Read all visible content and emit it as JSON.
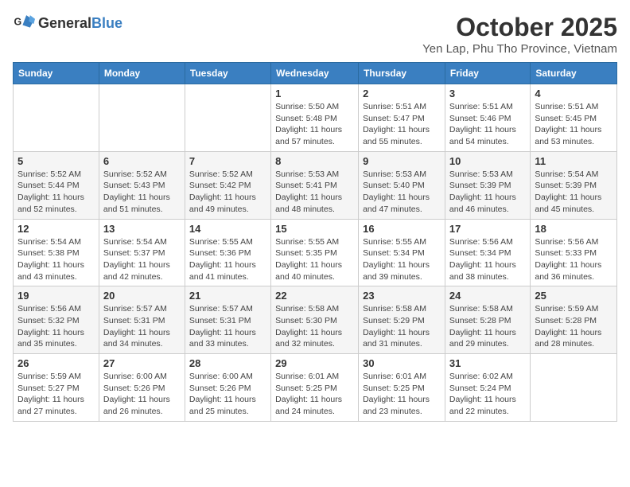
{
  "logo": {
    "text_general": "General",
    "text_blue": "Blue"
  },
  "title": "October 2025",
  "subtitle": "Yen Lap, Phu Tho Province, Vietnam",
  "weekdays": [
    "Sunday",
    "Monday",
    "Tuesday",
    "Wednesday",
    "Thursday",
    "Friday",
    "Saturday"
  ],
  "weeks": [
    [
      {
        "day": "",
        "info": ""
      },
      {
        "day": "",
        "info": ""
      },
      {
        "day": "",
        "info": ""
      },
      {
        "day": "1",
        "info": "Sunrise: 5:50 AM\nSunset: 5:48 PM\nDaylight: 11 hours and 57 minutes."
      },
      {
        "day": "2",
        "info": "Sunrise: 5:51 AM\nSunset: 5:47 PM\nDaylight: 11 hours and 55 minutes."
      },
      {
        "day": "3",
        "info": "Sunrise: 5:51 AM\nSunset: 5:46 PM\nDaylight: 11 hours and 54 minutes."
      },
      {
        "day": "4",
        "info": "Sunrise: 5:51 AM\nSunset: 5:45 PM\nDaylight: 11 hours and 53 minutes."
      }
    ],
    [
      {
        "day": "5",
        "info": "Sunrise: 5:52 AM\nSunset: 5:44 PM\nDaylight: 11 hours and 52 minutes."
      },
      {
        "day": "6",
        "info": "Sunrise: 5:52 AM\nSunset: 5:43 PM\nDaylight: 11 hours and 51 minutes."
      },
      {
        "day": "7",
        "info": "Sunrise: 5:52 AM\nSunset: 5:42 PM\nDaylight: 11 hours and 49 minutes."
      },
      {
        "day": "8",
        "info": "Sunrise: 5:53 AM\nSunset: 5:41 PM\nDaylight: 11 hours and 48 minutes."
      },
      {
        "day": "9",
        "info": "Sunrise: 5:53 AM\nSunset: 5:40 PM\nDaylight: 11 hours and 47 minutes."
      },
      {
        "day": "10",
        "info": "Sunrise: 5:53 AM\nSunset: 5:39 PM\nDaylight: 11 hours and 46 minutes."
      },
      {
        "day": "11",
        "info": "Sunrise: 5:54 AM\nSunset: 5:39 PM\nDaylight: 11 hours and 45 minutes."
      }
    ],
    [
      {
        "day": "12",
        "info": "Sunrise: 5:54 AM\nSunset: 5:38 PM\nDaylight: 11 hours and 43 minutes."
      },
      {
        "day": "13",
        "info": "Sunrise: 5:54 AM\nSunset: 5:37 PM\nDaylight: 11 hours and 42 minutes."
      },
      {
        "day": "14",
        "info": "Sunrise: 5:55 AM\nSunset: 5:36 PM\nDaylight: 11 hours and 41 minutes."
      },
      {
        "day": "15",
        "info": "Sunrise: 5:55 AM\nSunset: 5:35 PM\nDaylight: 11 hours and 40 minutes."
      },
      {
        "day": "16",
        "info": "Sunrise: 5:55 AM\nSunset: 5:34 PM\nDaylight: 11 hours and 39 minutes."
      },
      {
        "day": "17",
        "info": "Sunrise: 5:56 AM\nSunset: 5:34 PM\nDaylight: 11 hours and 38 minutes."
      },
      {
        "day": "18",
        "info": "Sunrise: 5:56 AM\nSunset: 5:33 PM\nDaylight: 11 hours and 36 minutes."
      }
    ],
    [
      {
        "day": "19",
        "info": "Sunrise: 5:56 AM\nSunset: 5:32 PM\nDaylight: 11 hours and 35 minutes."
      },
      {
        "day": "20",
        "info": "Sunrise: 5:57 AM\nSunset: 5:31 PM\nDaylight: 11 hours and 34 minutes."
      },
      {
        "day": "21",
        "info": "Sunrise: 5:57 AM\nSunset: 5:31 PM\nDaylight: 11 hours and 33 minutes."
      },
      {
        "day": "22",
        "info": "Sunrise: 5:58 AM\nSunset: 5:30 PM\nDaylight: 11 hours and 32 minutes."
      },
      {
        "day": "23",
        "info": "Sunrise: 5:58 AM\nSunset: 5:29 PM\nDaylight: 11 hours and 31 minutes."
      },
      {
        "day": "24",
        "info": "Sunrise: 5:58 AM\nSunset: 5:28 PM\nDaylight: 11 hours and 29 minutes."
      },
      {
        "day": "25",
        "info": "Sunrise: 5:59 AM\nSunset: 5:28 PM\nDaylight: 11 hours and 28 minutes."
      }
    ],
    [
      {
        "day": "26",
        "info": "Sunrise: 5:59 AM\nSunset: 5:27 PM\nDaylight: 11 hours and 27 minutes."
      },
      {
        "day": "27",
        "info": "Sunrise: 6:00 AM\nSunset: 5:26 PM\nDaylight: 11 hours and 26 minutes."
      },
      {
        "day": "28",
        "info": "Sunrise: 6:00 AM\nSunset: 5:26 PM\nDaylight: 11 hours and 25 minutes."
      },
      {
        "day": "29",
        "info": "Sunrise: 6:01 AM\nSunset: 5:25 PM\nDaylight: 11 hours and 24 minutes."
      },
      {
        "day": "30",
        "info": "Sunrise: 6:01 AM\nSunset: 5:25 PM\nDaylight: 11 hours and 23 minutes."
      },
      {
        "day": "31",
        "info": "Sunrise: 6:02 AM\nSunset: 5:24 PM\nDaylight: 11 hours and 22 minutes."
      },
      {
        "day": "",
        "info": ""
      }
    ]
  ]
}
